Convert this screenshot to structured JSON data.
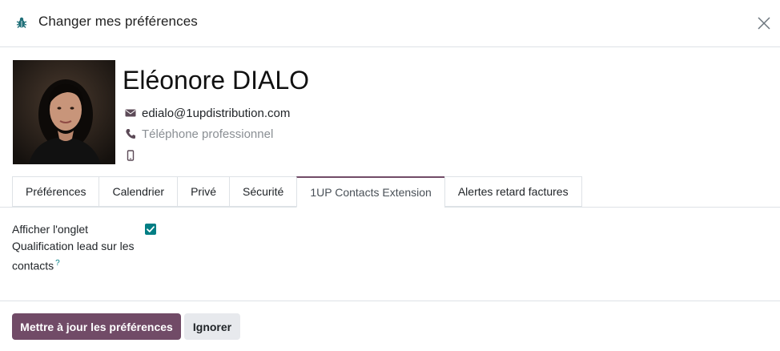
{
  "dialog": {
    "title": "Changer mes préférences",
    "icon": "bug-icon",
    "close_icon": "close-icon"
  },
  "user": {
    "name": "Eléonore DIALO",
    "email": "edialo@1updistribution.com",
    "phone_placeholder": "Téléphone professionnel",
    "mobile": ""
  },
  "tabs": [
    {
      "label": "Préférences",
      "active": false
    },
    {
      "label": "Calendrier",
      "active": false
    },
    {
      "label": "Privé",
      "active": false
    },
    {
      "label": "Sécurité",
      "active": false
    },
    {
      "label": "1UP Contacts Extension",
      "active": true
    },
    {
      "label": "Alertes retard factures",
      "active": false
    }
  ],
  "content": {
    "field_label": "Afficher l'onglet Qualification lead sur les contacts",
    "help": "?",
    "checked": true
  },
  "footer": {
    "primary_label": "Mettre à jour les préférences",
    "secondary_label": "Ignorer"
  },
  "colors": {
    "primary": "#714b67",
    "checkbox": "#017e84"
  }
}
